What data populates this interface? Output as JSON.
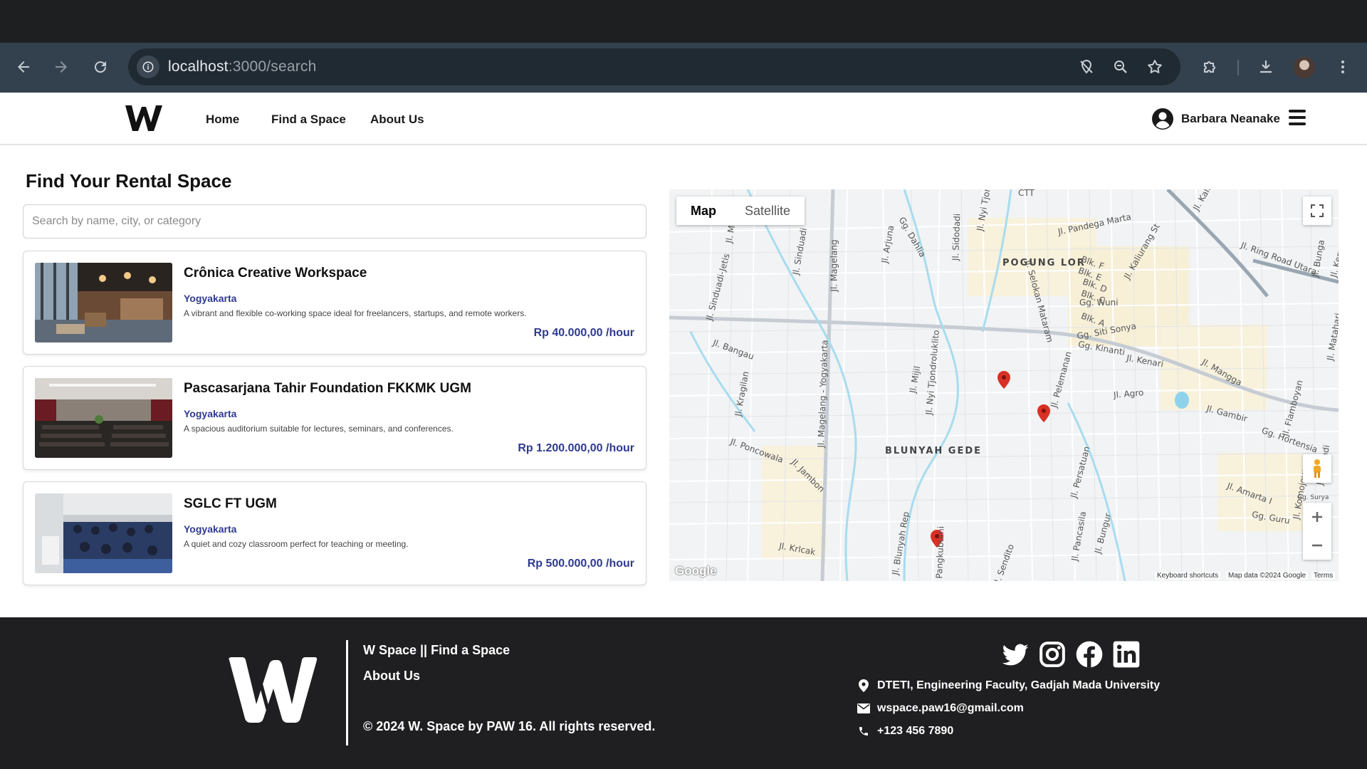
{
  "browser": {
    "url_host": "localhost",
    "url_path": ":3000/search"
  },
  "header": {
    "nav": [
      "Home",
      "Find a Space",
      "About Us"
    ],
    "user_name": "Barbara Neanake"
  },
  "main": {
    "title": "Find Your Rental Space",
    "search_placeholder": "Search by name, city, or category",
    "listings": [
      {
        "name": "Crônica Creative Workspace",
        "city": "Yogyakarta",
        "description": "A vibrant and flexible co-working space ideal for freelancers, startups, and remote workers.",
        "price": "Rp 40.000,00 /hour"
      },
      {
        "name": "Pascasarjana Tahir Foundation FKKMK UGM",
        "city": "Yogyakarta",
        "description": "A spacious auditorium suitable for lectures, seminars, and conferences.",
        "price": "Rp 1.200.000,00 /hour"
      },
      {
        "name": "SGLC FT UGM",
        "city": "Yogyakarta",
        "description": "A quiet and cozy classroom perfect for teaching or meeting.",
        "price": "Rp 500.000,00 /hour"
      }
    ]
  },
  "map": {
    "tabs": [
      "Map",
      "Satellite"
    ],
    "areas": [
      "POGUNG LOR",
      "BLUNYAH GEDE"
    ],
    "streets": [
      "Jl. Pandega Marta",
      "Jl. Ring Road Utara",
      "Jl. Kaliurang St",
      "Jl. Magelang",
      "Jl. Sinduadi",
      "Jl. Monjali",
      "Gg. Dahlia",
      "Jl. Arjuna",
      "Jl. Sidodadi",
      "Jl. Nyi Tjon",
      "Jl. Selokan Mataram",
      "Gg. Wuni",
      "Blk. F",
      "Blk. E",
      "Blk. D",
      "Blk. C",
      "Blk. A",
      "Gg. Siti Sonya",
      "Gg. Kinanti",
      "Jl. Kenari",
      "Jl. Mangga",
      "Jl. Sinduadi-Jetis",
      "Jl. Bangau",
      "Jl. Magelang - Yogyakarta",
      "Jl. Nyi Tjondroluklito",
      "Jl. Mijil",
      "Jl. Kragilan",
      "Jl. Pelemanan",
      "Jl. Agro",
      "Jl. Gambir",
      "Jl. Flamboyan",
      "Gg. Hortensia",
      "Jl. Poncowala",
      "Jl. Jambon",
      "Jl. Persatuan",
      "Jl. Amarta I",
      "Jl. Komojoyo",
      "Gg. Guru",
      "Jl. Krlcak",
      "Jl. Blunyah Rep",
      "Jl. Pangkubumi",
      "Jl. Pancasila",
      "Jl. Bungur",
      "Jl. Sendito",
      "Jl. Affandi",
      "Jl. Bunga",
      "Jl. Kemuning",
      "Jl. Matahari",
      "Jl. Kali",
      "Gg. Surya",
      "CTT"
    ],
    "attribution": [
      "Keyboard shortcuts",
      "Map data ©2024 Google",
      "Terms"
    ],
    "google": "Google"
  },
  "footer": {
    "brand_line": "W Space || Find a Space",
    "about": "About Us",
    "copyright": "© 2024 W. Space by PAW 16. All rights reserved.",
    "address": "DTETI, Engineering Faculty, Gadjah Mada University",
    "email": "wspace.paw16@gmail.com",
    "phone": "+123 456 7890"
  },
  "colors": {
    "accent": "#2f3a8f",
    "chrome": "#33414f",
    "footer_bg": "#1f1f21",
    "map_pin": "#d93025"
  }
}
